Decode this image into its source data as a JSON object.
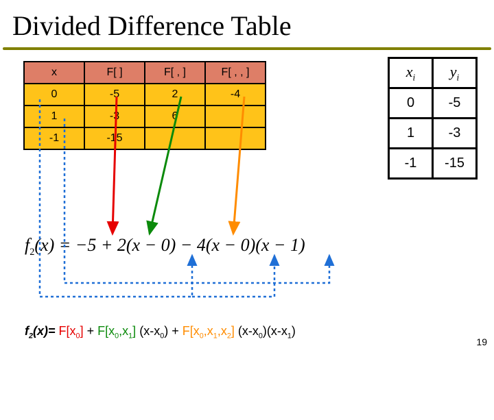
{
  "title": "Divided Difference Table",
  "dd_table": {
    "headers": [
      "x",
      "F[ ]",
      "F[ , ]",
      "F[ , , ]"
    ],
    "rows": [
      [
        "0",
        "-5",
        "2",
        "-4"
      ],
      [
        "1",
        "-3",
        "6",
        ""
      ],
      [
        "-1",
        "-15",
        "",
        ""
      ]
    ]
  },
  "xy_table": {
    "h0_base": "x",
    "h0_sub": "i",
    "h1_base": "y",
    "h1_sub": "i",
    "rows": [
      [
        "0",
        "-5"
      ],
      [
        "1",
        "-3"
      ],
      [
        "-1",
        "-15"
      ]
    ]
  },
  "formula": {
    "fbase": "f",
    "fsub": "2",
    "text": "(x) = −5 + 2(x − 0) − 4(x − 0)(x − 1)"
  },
  "gen_formula": {
    "lhs_base": "f",
    "lhs_sub": "2",
    "lhs_tail": "(x)=",
    "term0": "F[x",
    "term0_sub": "0",
    "term0_tail": "]",
    "plus1": "+",
    "term1": "F[x",
    "term1_sub1": "0",
    "term1_mid": ",x",
    "term1_sub2": "1",
    "term1_tail": "]",
    "factor1a": " (x-x",
    "factor1a_sub": "0",
    "factor1a_tail": ")",
    "plus2": "+",
    "term2": "F[x",
    "term2_sub1": "0",
    "term2_mid1": ",x",
    "term2_sub2": "1",
    "term2_mid2": ",x",
    "term2_sub3": "2",
    "term2_tail": "]",
    "factor2a": " (x-x",
    "factor2a_sub": "0",
    "factor2a_tail": ")(x-x",
    "factor2b_sub": "1",
    "factor2b_tail": ")"
  },
  "page_number": "19",
  "colors": {
    "red": "#e60000",
    "green": "#0b8a0b",
    "orange": "#ff8c00",
    "blue": "#1f6fd6"
  }
}
